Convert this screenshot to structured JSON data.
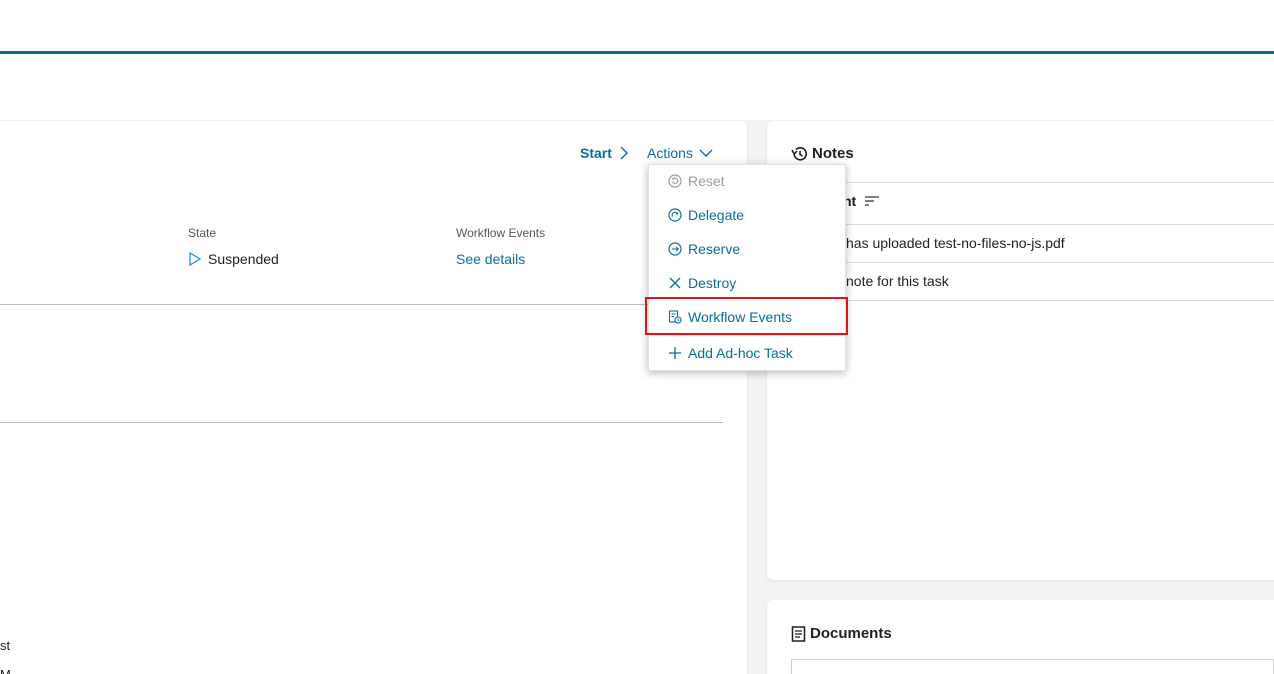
{
  "header": {
    "start_label": "Start",
    "actions_label": "Actions"
  },
  "fields": {
    "state_label": "State",
    "state_value": "Suspended",
    "workflow_label": "Workflow Events",
    "workflow_link": "See details"
  },
  "left_fragments": [
    "st",
    "M"
  ],
  "actions_menu": {
    "items": [
      {
        "label": "Reset",
        "icon": "reset-icon",
        "disabled": true
      },
      {
        "label": "Delegate",
        "icon": "delegate-icon"
      },
      {
        "label": "Reserve",
        "icon": "reserve-icon"
      },
      {
        "label": "Destroy",
        "icon": "close-icon"
      },
      {
        "label": "Workflow Events",
        "icon": "workflow-events-icon",
        "highlighted": true
      },
      {
        "label": "Add Ad-hoc Task",
        "icon": "plus-icon"
      }
    ]
  },
  "notes": {
    "title": "Notes",
    "column_header": "nt",
    "rows": [
      "has uploaded test-no-files-no-js.pdf",
      "note for this task"
    ]
  },
  "documents": {
    "title": "Documents"
  },
  "colors": {
    "accent": "#0a6e99",
    "highlight": "#e0131b"
  }
}
